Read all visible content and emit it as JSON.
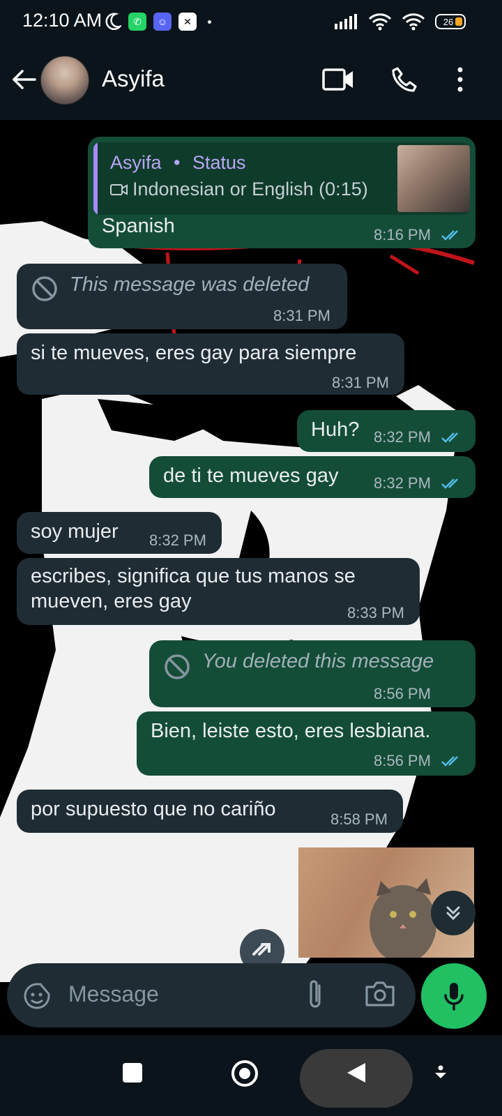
{
  "status_bar": {
    "time": "12:10 AM",
    "battery": "26"
  },
  "header": {
    "contact_name": "Asyifa",
    "icons": [
      "back-arrow-icon",
      "video-call-icon",
      "voice-call-icon",
      "more-icon"
    ]
  },
  "messages": [
    {
      "dir": "out",
      "quote_name": "Asyifa",
      "quote_sep": "•",
      "quote_source": "Status",
      "quote_sub": "Indonesian or English (0:15)",
      "text": "Spanish",
      "time": "8:16 PM",
      "read": true
    },
    {
      "dir": "in",
      "deleted": true,
      "text": "This message was deleted",
      "time": "8:31 PM"
    },
    {
      "dir": "in",
      "text": "si te mueves, eres gay para siempre",
      "time": "8:31 PM"
    },
    {
      "dir": "out",
      "text": "Huh?",
      "time": "8:32 PM",
      "read": true
    },
    {
      "dir": "out",
      "text": "de ti te mueves gay",
      "time": "8:32 PM",
      "read": true
    },
    {
      "dir": "in",
      "text": "soy mujer",
      "time": "8:32 PM"
    },
    {
      "dir": "in",
      "text_line1": "escribes, significa que tus manos se",
      "text_line2": "mueven, eres gay",
      "time": "8:33 PM"
    },
    {
      "dir": "out",
      "deleted": true,
      "text": "You deleted this message",
      "time": "8:56 PM"
    },
    {
      "dir": "out",
      "text": "Bien, leiste esto, eres lesbiana.",
      "time": "8:56 PM",
      "read": true
    },
    {
      "dir": "in",
      "text": "por supuesto que no cariño",
      "time": "8:58 PM"
    }
  ],
  "composer": {
    "placeholder": "Message"
  },
  "colors": {
    "incoming": "#1f2c34",
    "outgoing": "#144d37",
    "accent_green": "#21c063",
    "read_ticks": "#53bdeb"
  }
}
